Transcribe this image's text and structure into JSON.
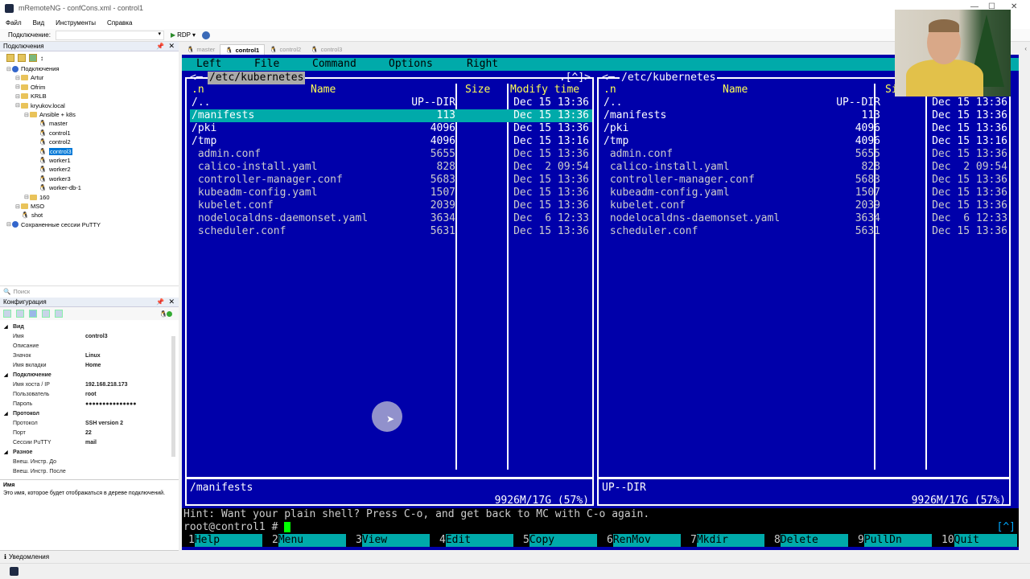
{
  "window": {
    "title": "mRemoteNG - confCons.xml - control1"
  },
  "menu": [
    "Файл",
    "Вид",
    "Инструменты",
    "Справка"
  ],
  "toolbar": {
    "connect_label": "Подключение:",
    "protocol": "RDP"
  },
  "connections_panel": {
    "title": "Подключения"
  },
  "tree": [
    {
      "label": "Подключения",
      "level": 0,
      "type": "root"
    },
    {
      "label": "Artur",
      "level": 1,
      "type": "folder"
    },
    {
      "label": "Ofrim",
      "level": 1,
      "type": "folder"
    },
    {
      "label": "KRLB",
      "level": 1,
      "type": "folder"
    },
    {
      "label": "kryukov.local",
      "level": 1,
      "type": "folder"
    },
    {
      "label": "Ansible + k8s",
      "level": 2,
      "type": "folder"
    },
    {
      "label": "master",
      "level": 3,
      "type": "linux"
    },
    {
      "label": "control1",
      "level": 3,
      "type": "linux"
    },
    {
      "label": "control2",
      "level": 3,
      "type": "linux"
    },
    {
      "label": "control3",
      "level": 3,
      "type": "linux",
      "selected": true
    },
    {
      "label": "worker1",
      "level": 3,
      "type": "linux"
    },
    {
      "label": "worker2",
      "level": 3,
      "type": "linux"
    },
    {
      "label": "worker3",
      "level": 3,
      "type": "linux"
    },
    {
      "label": "worker-db-1",
      "level": 3,
      "type": "linux"
    },
    {
      "label": "160",
      "level": 2,
      "type": "folder"
    },
    {
      "label": "MSO",
      "level": 1,
      "type": "folder"
    },
    {
      "label": "shot",
      "level": 1,
      "type": "linux"
    },
    {
      "label": "Сохраненные сессии PuTTY",
      "level": 0,
      "type": "putty"
    }
  ],
  "search": {
    "placeholder": "Поиск"
  },
  "config_panel": {
    "title": "Конфигурация"
  },
  "properties": [
    {
      "cat": true,
      "key": "Вид"
    },
    {
      "key": "Имя",
      "value": "control3"
    },
    {
      "key": "Описание",
      "value": ""
    },
    {
      "key": "Значок",
      "value": "Linux"
    },
    {
      "key": "Имя вкладки",
      "value": "Home"
    },
    {
      "cat": true,
      "key": "Подключение"
    },
    {
      "key": "Имя хоста / IP",
      "value": "192.168.218.173"
    },
    {
      "key": "Пользователь",
      "value": "root"
    },
    {
      "key": "Пароль",
      "value": "●●●●●●●●●●●●●●●"
    },
    {
      "cat": true,
      "key": "Протокол"
    },
    {
      "key": "Протокол",
      "value": "SSH version 2"
    },
    {
      "key": "Порт",
      "value": "22"
    },
    {
      "key": "Сессии PuTTY",
      "value": "mail"
    },
    {
      "cat": true,
      "key": "Разное"
    },
    {
      "key": "Внеш. Инстр. До",
      "value": ""
    },
    {
      "key": "Внеш. Инстр. После",
      "value": ""
    }
  ],
  "description": {
    "title": "Имя",
    "text": "Это имя, которое будет отображаться в дереве подключений."
  },
  "notifications": {
    "label": "Уведомления"
  },
  "tabs": [
    {
      "label": "master",
      "active": false
    },
    {
      "label": "control1",
      "active": true
    },
    {
      "label": "control2",
      "active": false
    },
    {
      "label": "control3",
      "active": false
    }
  ],
  "mc": {
    "menu": [
      "Left",
      "File",
      "Command",
      "Options",
      "Right"
    ],
    "left_title": " /etc/kubernetes ",
    "right_title": " /etc/kubernetes ",
    "left_corner": "<─",
    "right_corner_left": ".[^]>",
    "right_corner_right": "<─",
    "col_n": ".n",
    "col_name": "Name",
    "col_size": "Size",
    "col_modify": "Modify time",
    "col_size_right": "Si",
    "rows": [
      {
        "name": "/..",
        "size": "UP--DIR",
        "time": "Dec 15 13:36",
        "type": "dir"
      },
      {
        "name": "/manifests",
        "size": "113",
        "time": "Dec 15 13:36",
        "type": "dir"
      },
      {
        "name": "/pki",
        "size": "4096",
        "time": "Dec 15 13:36",
        "type": "dir"
      },
      {
        "name": "/tmp",
        "size": "4096",
        "time": "Dec 15 13:16",
        "type": "dir"
      },
      {
        "name": " admin.conf",
        "size": "5655",
        "time": "Dec 15 13:36",
        "type": "file"
      },
      {
        "name": " calico-install.yaml",
        "size": "828",
        "time": "Dec  2 09:54",
        "type": "file"
      },
      {
        "name": " controller-manager.conf",
        "size": "5683",
        "time": "Dec 15 13:36",
        "type": "file"
      },
      {
        "name": " kubeadm-config.yaml",
        "size": "1507",
        "time": "Dec 15 13:36",
        "type": "file"
      },
      {
        "name": " kubelet.conf",
        "size": "2039",
        "time": "Dec 15 13:36",
        "type": "file"
      },
      {
        "name": " nodelocaldns-daemonset.yaml",
        "size": "3634",
        "time": "Dec  6 12:33",
        "type": "file"
      },
      {
        "name": " scheduler.conf",
        "size": "5631",
        "time": "Dec 15 13:36",
        "type": "file"
      }
    ],
    "left_status": "/manifests",
    "right_status": "UP--DIR",
    "left_free": "9926M/17G (57%)",
    "right_free": "9926M/17G (57%)",
    "hint": "Hint: Want your plain shell? Press C-o, and get back to MC with C-o again.",
    "prompt": "root@control1 # ",
    "overflow": "[^]",
    "fkeys": [
      {
        "n": "1",
        "l": "Help"
      },
      {
        "n": "2",
        "l": "Menu"
      },
      {
        "n": "3",
        "l": "View"
      },
      {
        "n": "4",
        "l": "Edit"
      },
      {
        "n": "5",
        "l": "Copy"
      },
      {
        "n": "6",
        "l": "RenMov"
      },
      {
        "n": "7",
        "l": "Mkdir"
      },
      {
        "n": "8",
        "l": "Delete"
      },
      {
        "n": "9",
        "l": "PullDn"
      },
      {
        "n": "10",
        "l": "Quit"
      }
    ]
  }
}
